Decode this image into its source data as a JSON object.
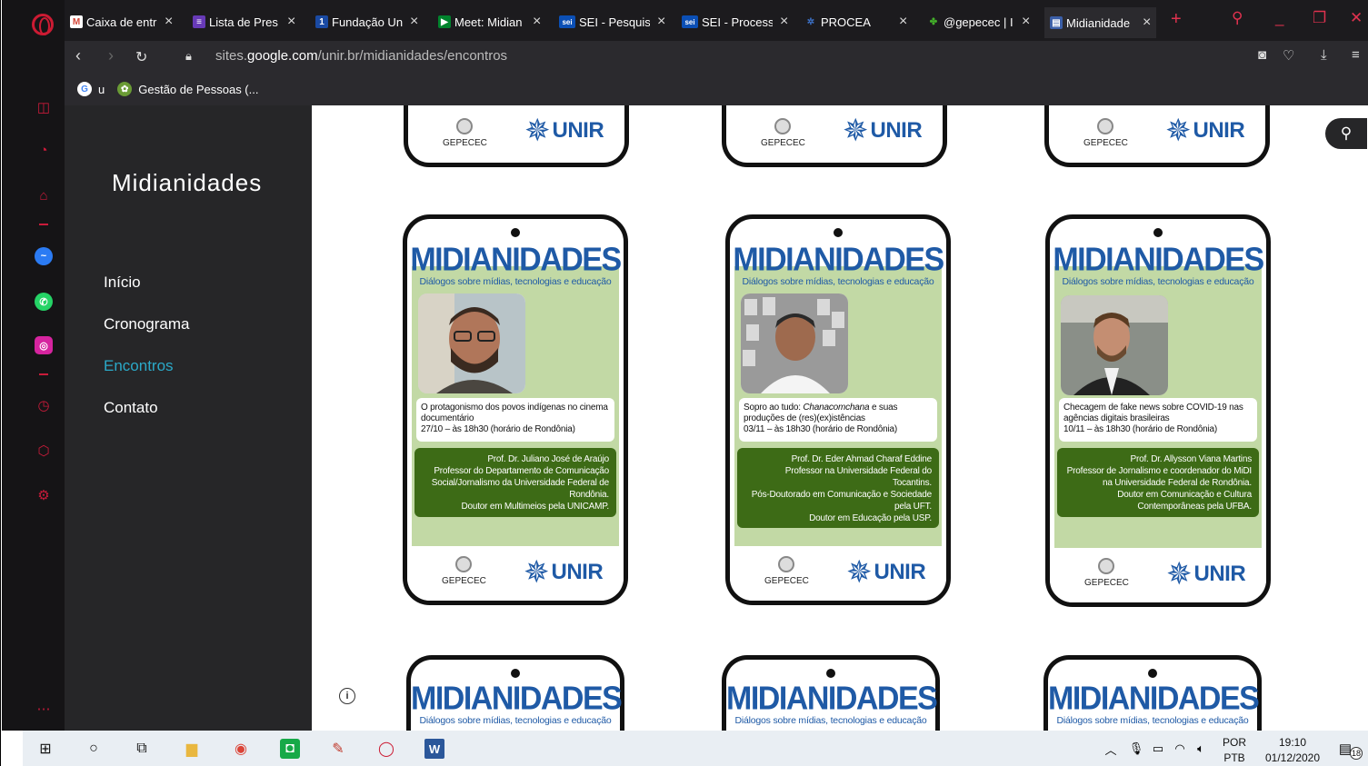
{
  "browser": {
    "tabs": [
      {
        "label": "Caixa de entr",
        "icon": "gmail-icon",
        "fav": "M",
        "color": "#d44638"
      },
      {
        "label": "Lista de Pres",
        "icon": "forms-icon",
        "fav": "≡",
        "color": "#673ab7"
      },
      {
        "label": "Fundação Un",
        "icon": "page-icon",
        "fav": "1",
        "color": "#1a4aa3"
      },
      {
        "label": "Meet: Midian",
        "icon": "meet-icon",
        "fav": "▶",
        "color": "#00832d"
      },
      {
        "label": "SEI - Pesquis",
        "icon": "sei-icon",
        "fav": "sei",
        "color": "#0b4fb5"
      },
      {
        "label": "SEI - Process",
        "icon": "sei-icon",
        "fav": "sei",
        "color": "#0b4fb5"
      },
      {
        "label": "PROCEA",
        "icon": "procea-icon",
        "fav": "✲",
        "color": "#3b6fc4"
      },
      {
        "label": "@gepecec | I",
        "icon": "linktree-icon",
        "fav": "✤",
        "color": "#43b02a"
      },
      {
        "label": "Midianidade",
        "icon": "sites-icon",
        "fav": "▤",
        "color": "#3b5fa8"
      }
    ],
    "close_glyph": "×",
    "new_tab": "+",
    "url_prefix": "sites.",
    "url_domain": "google.com",
    "url_path": "/unir.br/midianidades/encontros",
    "bookmarks": [
      {
        "label": "u",
        "icon": "google-icon"
      },
      {
        "label": "Gestão de Pessoas (...",
        "icon": "bookmark-icon"
      }
    ]
  },
  "site": {
    "title": "Midianidades",
    "nav": [
      "Início",
      "Cronograma",
      "Encontros",
      "Contato"
    ],
    "current": "Encontros"
  },
  "cards": [
    {
      "heading": "MIDIANIDADES",
      "subheading": "Diálogos sobre mídias, tecnologias e educação",
      "topic": "O protagonismo dos povos indígenas no cinema documentário",
      "date": "27/10 – às 18h30 (horário de Rondônia)",
      "bio": [
        "Prof. Dr. Juliano José de Araújo",
        "Professor do Departamento de Comunicação Social/Jornalismo da Universidade Federal de Rondônia.",
        "Doutor em Multimeios pela UNICAMP."
      ]
    },
    {
      "heading": "MIDIANIDADES",
      "subheading": "Diálogos sobre mídias, tecnologias e educação",
      "topic_pre": "Sopro ao tudo: ",
      "topic_em": "Chanacomchana",
      "topic_post": " e suas produções de (res)(ex)istências",
      "date": "03/11 – às 18h30 (horário de Rondônia)",
      "bio": [
        "Prof. Dr. Eder Ahmad Charaf Eddine",
        "Professor na Universidade Federal do Tocantins.",
        "Pós-Doutorado em Comunicação e Sociedade pela UFT.",
        "Doutor em Educação pela USP."
      ]
    },
    {
      "heading": "MIDIANIDADES",
      "subheading": "Diálogos sobre mídias, tecnologias e educação",
      "topic": "Checagem de fake news sobre COVID-19 nas agências digitais brasileiras",
      "date": "10/11 – às 18h30 (horário de Rondônia)",
      "bio": [
        "Prof. Dr. Allysson Viana Martins",
        "Professor de Jornalismo e coordenador do MiDI na Universidade Federal de Rondônia.",
        "Doutor em Comunicação e Cultura Contemporâneas pela UFBA."
      ]
    }
  ],
  "footer_logos": {
    "gepecec": "GEPECEC",
    "unir": "UNIR"
  },
  "taskbar": {
    "language_line1": "POR",
    "language_line2": "PTB",
    "time": "19:10",
    "date": "01/12/2020",
    "notifications": "18"
  }
}
